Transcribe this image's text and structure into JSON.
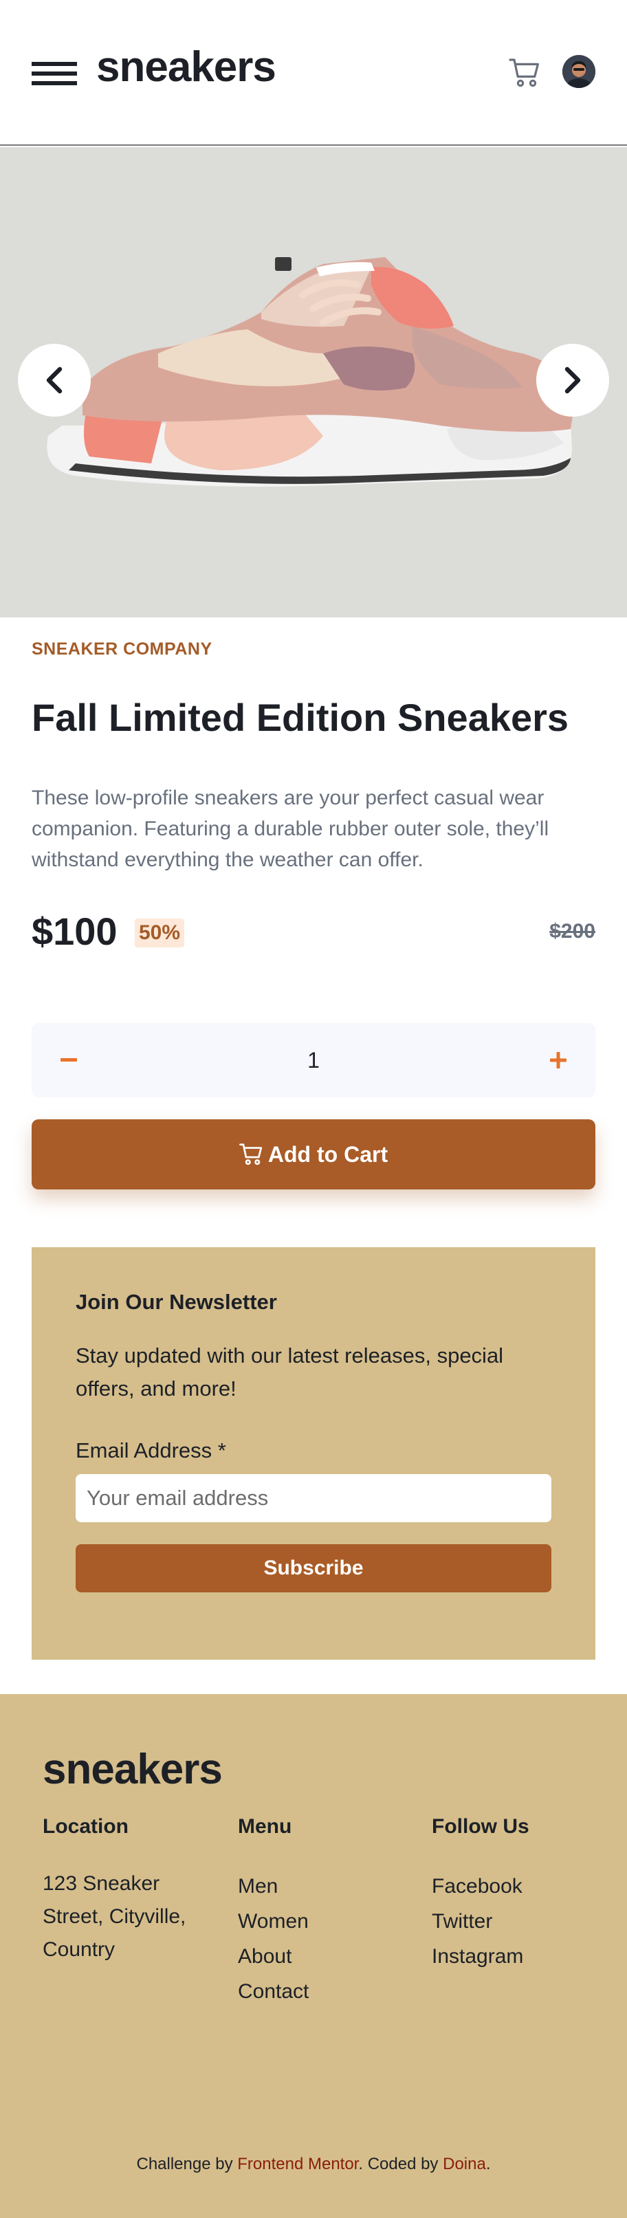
{
  "header": {
    "logo": "sneakers",
    "menu_icon": "hamburger-menu-icon",
    "cart_icon": "cart-icon",
    "avatar_icon": "avatar"
  },
  "gallery": {
    "prev_icon": "chevron-left-icon",
    "next_icon": "chevron-right-icon"
  },
  "product": {
    "company": "SNEAKER COMPANY",
    "title": "Fall Limited Edition Sneakers",
    "description": "These low-profile sneakers are your perfect casual wear companion. Featuring a durable rubber outer sole, they’ll withstand everything the weather can offer.",
    "price": "$100",
    "discount": "50%",
    "original_price": "$200",
    "quantity": "1",
    "minus_symbol": "−",
    "plus_symbol": "+",
    "add_to_cart_label": "Add to Cart"
  },
  "newsletter": {
    "title": "Join Our Newsletter",
    "text": "Stay updated with our latest releases, special offers, and more!",
    "email_label": "Email Address *",
    "email_placeholder": "Your email address",
    "email_value": "",
    "subscribe_label": "Subscribe"
  },
  "footer": {
    "logo": "sneakers",
    "location": {
      "title": "Location",
      "address": "123 Sneaker Street, Cityville, Country"
    },
    "menu": {
      "title": "Menu",
      "items": [
        "Men",
        "Women",
        "About",
        "Contact"
      ]
    },
    "follow": {
      "title": "Follow Us",
      "items": [
        "Facebook",
        "Twitter",
        "Instagram"
      ]
    },
    "attribution": {
      "prefix": "Challenge by ",
      "link1": "Frontend Mentor",
      "middle": ". Coded by ",
      "link2": "Doina",
      "suffix": "."
    }
  },
  "colors": {
    "accent": "#a95c27",
    "accent_text": "#a45b27",
    "discount_bg": "#fde8d9",
    "newsletter_bg": "#d5be8c",
    "image_bg": "#dcdcd8",
    "qty_bg": "#f6f8fd",
    "link": "#8b1d0a"
  }
}
